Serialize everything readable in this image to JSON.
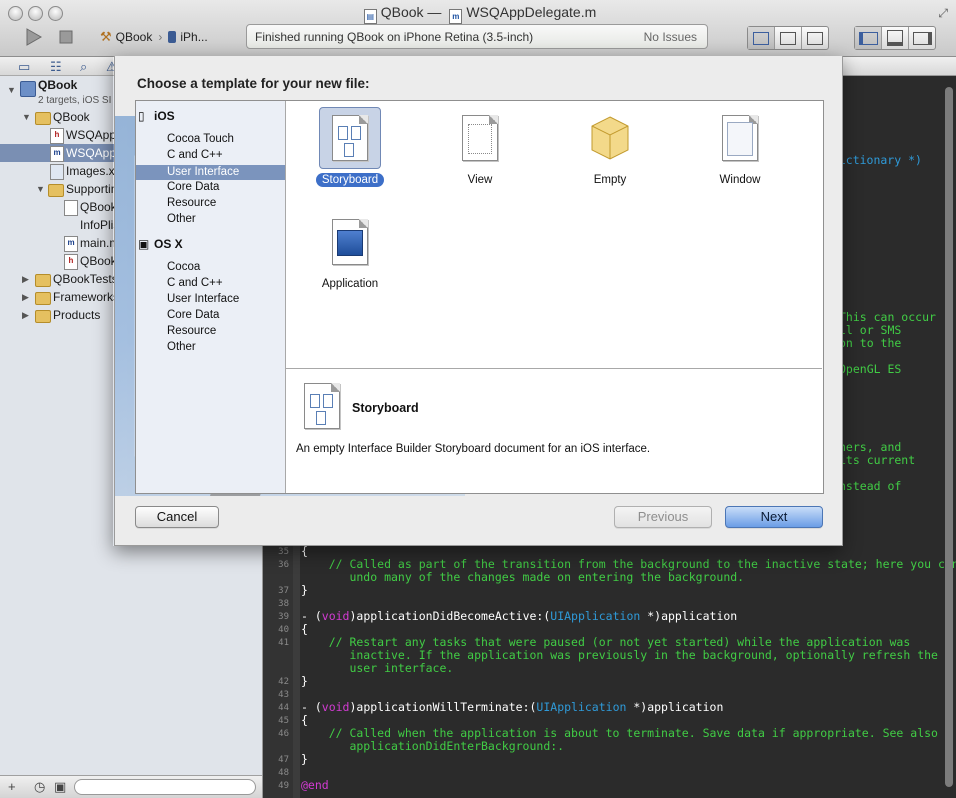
{
  "window": {
    "app_title": "QBook",
    "separator": "—",
    "file_title": "WSQAppDelegate.m"
  },
  "toolbar": {
    "scheme_target": "QBook",
    "scheme_device": "iPh...",
    "activity_status": "Finished running QBook on iPhone Retina (3.5-inch)",
    "activity_issues": "No Issues"
  },
  "navigator": {
    "project": {
      "name": "QBook",
      "subtitle": "2 targets, iOS SI"
    },
    "items": [
      {
        "label": "QBook",
        "kind": "folder"
      },
      {
        "label": "WSQAppl",
        "kind": "h"
      },
      {
        "label": "WSQAppl",
        "kind": "m"
      },
      {
        "label": "Images.x",
        "kind": "assets"
      },
      {
        "label": "Supportin",
        "kind": "folder"
      },
      {
        "label": "QBook",
        "kind": "plist"
      },
      {
        "label": "InfoPlis",
        "kind": "strings"
      },
      {
        "label": "main.m",
        "kind": "m"
      },
      {
        "label": "QBook",
        "kind": "h"
      },
      {
        "label": "QBookTests",
        "kind": "folder"
      },
      {
        "label": "Frameworks",
        "kind": "folder"
      },
      {
        "label": "Products",
        "kind": "folder"
      }
    ]
  },
  "editor": {
    "visible_fragments": [
      {
        "text": "SDictionary *)",
        "kind": "mixed"
      },
      {
        "text": "This can occur",
        "kind": "comment"
      },
      {
        "text": "ll or SMS",
        "kind": "comment"
      },
      {
        "text": "on to the",
        "kind": "comment"
      },
      {
        "text": "OpenGL ES",
        "kind": "comment"
      },
      {
        "text": "ners, and",
        "kind": "comment"
      },
      {
        "text": "its current",
        "kind": "comment"
      },
      {
        "text": "nstead of",
        "kind": "comment"
      }
    ],
    "lines": [
      {
        "num": "35",
        "text": "{"
      },
      {
        "num": "36",
        "comment": "    // Called as part of the transition from the background to the inactive state; here you can\n       undo many of the changes made on entering the background."
      },
      {
        "num": "37",
        "text": "}"
      },
      {
        "num": "38",
        "text": ""
      },
      {
        "num": "39",
        "prefix": "- (",
        "kw": "void",
        "mid": ")applicationDidBecomeActive:(",
        "ty": "UIApplication",
        "rest": " *)application"
      },
      {
        "num": "40",
        "text": "{"
      },
      {
        "num": "41",
        "comment": "    // Restart any tasks that were paused (or not yet started) while the application was\n       inactive. If the application was previously in the background, optionally refresh the\n       user interface."
      },
      {
        "num": "42",
        "text": "}"
      },
      {
        "num": "43",
        "text": ""
      },
      {
        "num": "44",
        "prefix": "- (",
        "kw": "void",
        "mid": ")applicationWillTerminate:(",
        "ty": "UIApplication",
        "rest": " *)application"
      },
      {
        "num": "45",
        "text": "{"
      },
      {
        "num": "46",
        "comment": "    // Called when the application is about to terminate. Save data if appropriate. See also\n       applicationDidEnterBackground:."
      },
      {
        "num": "47",
        "text": "}"
      },
      {
        "num": "48",
        "text": ""
      },
      {
        "num": "49",
        "kwline": "@end"
      }
    ]
  },
  "sheet": {
    "title": "Choose a template for your new file:",
    "platforms": [
      {
        "name": "iOS",
        "categories": [
          "Cocoa Touch",
          "C and C++",
          "User Interface",
          "Core Data",
          "Resource",
          "Other"
        ]
      },
      {
        "name": "OS X",
        "categories": [
          "Cocoa",
          "C and C++",
          "User Interface",
          "Core Data",
          "Resource",
          "Other"
        ]
      }
    ],
    "selected_category": "User Interface",
    "templates": [
      "Storyboard",
      "View",
      "Empty",
      "Window",
      "Application"
    ],
    "selected_template": "Storyboard",
    "detail": {
      "name": "Storyboard",
      "description": "An empty Interface Builder Storyboard document for an iOS interface."
    },
    "buttons": {
      "cancel": "Cancel",
      "previous": "Previous",
      "next": "Next"
    }
  },
  "colors": {
    "selection": "#3d6fc8",
    "comment": "#41cc45",
    "keyword": "#d33bd3",
    "type": "#2f9ad8",
    "editor_bg": "#2b2b2b"
  }
}
